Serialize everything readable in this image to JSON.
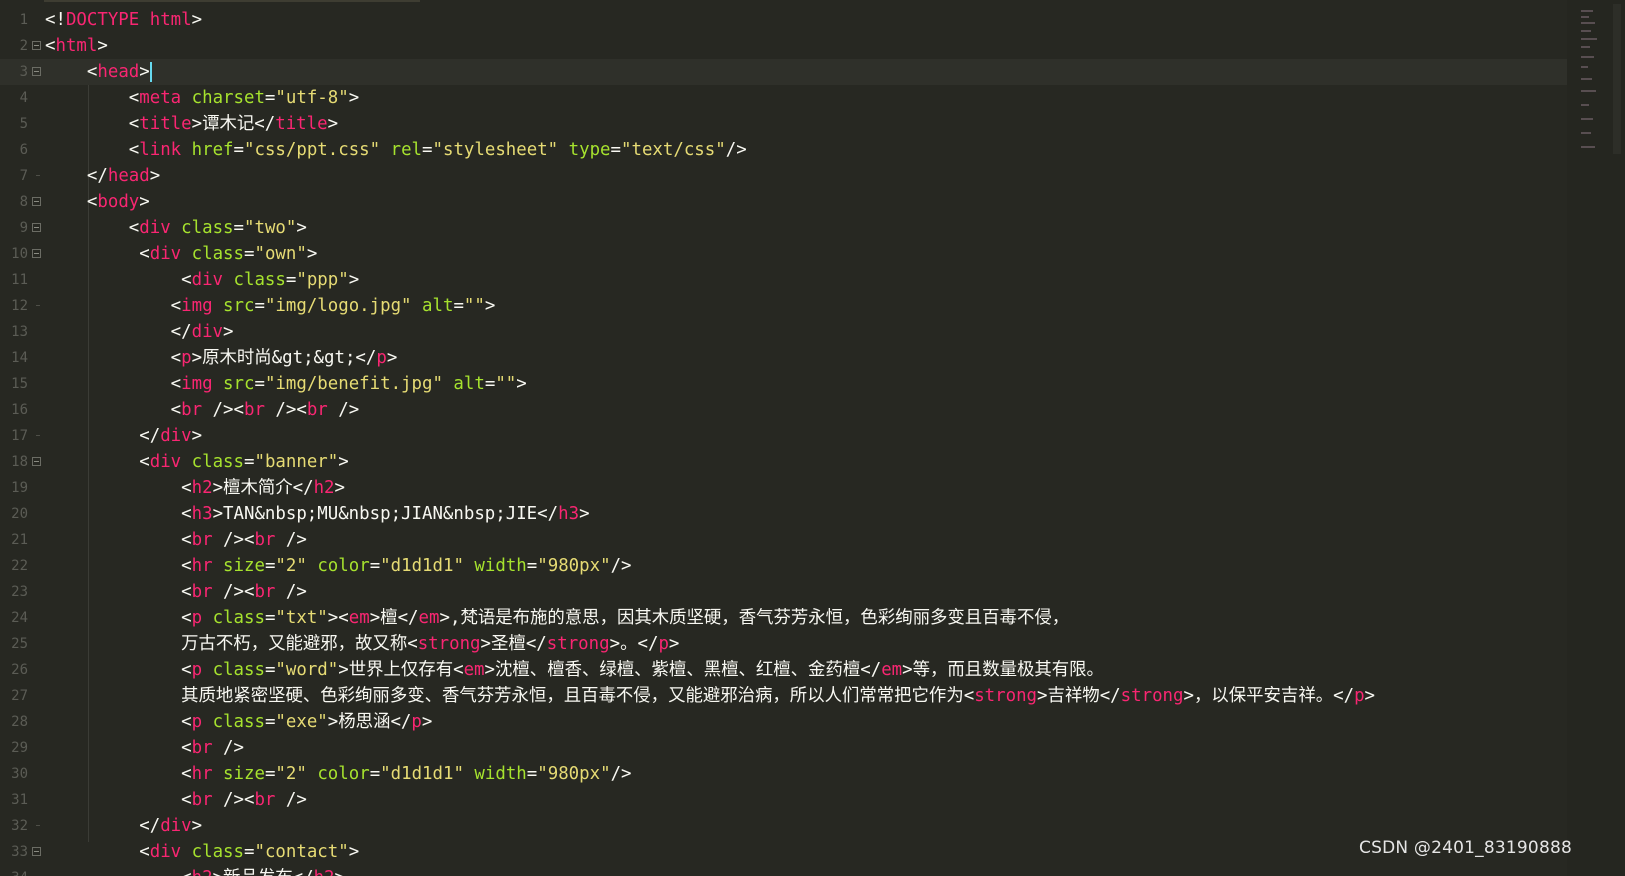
{
  "editor": {
    "theme_colors": {
      "background": "#272822",
      "tag": "#f92672",
      "attribute": "#a6e22e",
      "string": "#e6db74",
      "text": "#f8f8f2",
      "line_number": "#5b5c55",
      "cursor": "#66d9ef"
    },
    "cursor_line": 3,
    "lines": [
      {
        "n": "1",
        "fold": "",
        "ind": 0,
        "toks": [
          [
            "p",
            "<!"
          ],
          [
            "g",
            "DOCTYPE"
          ],
          [
            "p",
            " "
          ],
          [
            "g",
            "html"
          ],
          [
            "p",
            ">"
          ]
        ]
      },
      {
        "n": "2",
        "fold": "open",
        "ind": 0,
        "toks": [
          [
            "p",
            "<"
          ],
          [
            "g",
            "html"
          ],
          [
            "p",
            ">"
          ]
        ]
      },
      {
        "n": "3",
        "fold": "open",
        "ind": 4,
        "cursor": true,
        "toks": [
          [
            "p",
            "<"
          ],
          [
            "g",
            "head"
          ],
          [
            "p",
            ">"
          ]
        ]
      },
      {
        "n": "4",
        "fold": "",
        "ind": 8,
        "toks": [
          [
            "p",
            "<"
          ],
          [
            "g",
            "meta"
          ],
          [
            "p",
            " "
          ],
          [
            "a",
            "charset"
          ],
          [
            "p",
            "="
          ],
          [
            "s",
            "\"utf-8\""
          ],
          [
            "p",
            ">"
          ]
        ]
      },
      {
        "n": "5",
        "fold": "",
        "ind": 8,
        "toks": [
          [
            "p",
            "<"
          ],
          [
            "g",
            "title"
          ],
          [
            "p",
            ">"
          ],
          [
            "t",
            "谭木记"
          ],
          [
            "p",
            "</"
          ],
          [
            "g",
            "title"
          ],
          [
            "p",
            ">"
          ]
        ]
      },
      {
        "n": "6",
        "fold": "",
        "ind": 8,
        "toks": [
          [
            "p",
            "<"
          ],
          [
            "g",
            "link"
          ],
          [
            "p",
            " "
          ],
          [
            "a",
            "href"
          ],
          [
            "p",
            "="
          ],
          [
            "s",
            "\"css/ppt.css\""
          ],
          [
            "p",
            " "
          ],
          [
            "a",
            "rel"
          ],
          [
            "p",
            "="
          ],
          [
            "s",
            "\"stylesheet\""
          ],
          [
            "p",
            " "
          ],
          [
            "a",
            "type"
          ],
          [
            "p",
            "="
          ],
          [
            "s",
            "\"text/css\""
          ],
          [
            "p",
            "/>"
          ]
        ]
      },
      {
        "n": "7",
        "fold": "end",
        "ind": 4,
        "toks": [
          [
            "p",
            "</"
          ],
          [
            "g",
            "head"
          ],
          [
            "p",
            ">"
          ]
        ]
      },
      {
        "n": "8",
        "fold": "open",
        "ind": 4,
        "toks": [
          [
            "p",
            "<"
          ],
          [
            "g",
            "body"
          ],
          [
            "p",
            ">"
          ]
        ]
      },
      {
        "n": "9",
        "fold": "open",
        "ind": 8,
        "toks": [
          [
            "p",
            "<"
          ],
          [
            "g",
            "div"
          ],
          [
            "p",
            " "
          ],
          [
            "a",
            "class"
          ],
          [
            "p",
            "="
          ],
          [
            "s",
            "\"two\""
          ],
          [
            "p",
            ">"
          ]
        ]
      },
      {
        "n": "10",
        "fold": "open",
        "ind": 9,
        "toks": [
          [
            "p",
            "<"
          ],
          [
            "g",
            "div"
          ],
          [
            "p",
            " "
          ],
          [
            "a",
            "class"
          ],
          [
            "p",
            "="
          ],
          [
            "s",
            "\"own\""
          ],
          [
            "p",
            ">"
          ]
        ]
      },
      {
        "n": "11",
        "fold": "",
        "ind": 13,
        "toks": [
          [
            "p",
            "<"
          ],
          [
            "g",
            "div"
          ],
          [
            "p",
            " "
          ],
          [
            "a",
            "class"
          ],
          [
            "p",
            "="
          ],
          [
            "s",
            "\"ppp\""
          ],
          [
            "p",
            ">"
          ]
        ]
      },
      {
        "n": "12",
        "fold": "end",
        "ind": 12,
        "toks": [
          [
            "p",
            "<"
          ],
          [
            "g",
            "img"
          ],
          [
            "p",
            " "
          ],
          [
            "a",
            "src"
          ],
          [
            "p",
            "="
          ],
          [
            "s",
            "\"img/logo.jpg\""
          ],
          [
            "p",
            " "
          ],
          [
            "a",
            "alt"
          ],
          [
            "p",
            "="
          ],
          [
            "s",
            "\"\""
          ],
          [
            "p",
            ">"
          ]
        ]
      },
      {
        "n": "13",
        "fold": "",
        "ind": 12,
        "toks": [
          [
            "p",
            "</"
          ],
          [
            "g",
            "div"
          ],
          [
            "p",
            ">"
          ]
        ]
      },
      {
        "n": "14",
        "fold": "",
        "ind": 12,
        "toks": [
          [
            "p",
            "<"
          ],
          [
            "g",
            "p"
          ],
          [
            "p",
            ">"
          ],
          [
            "t",
            "原木时尚&gt;&gt;"
          ],
          [
            "p",
            "</"
          ],
          [
            "g",
            "p"
          ],
          [
            "p",
            ">"
          ]
        ]
      },
      {
        "n": "15",
        "fold": "",
        "ind": 12,
        "toks": [
          [
            "p",
            "<"
          ],
          [
            "g",
            "img"
          ],
          [
            "p",
            " "
          ],
          [
            "a",
            "src"
          ],
          [
            "p",
            "="
          ],
          [
            "s",
            "\"img/benefit.jpg\""
          ],
          [
            "p",
            " "
          ],
          [
            "a",
            "alt"
          ],
          [
            "p",
            "="
          ],
          [
            "s",
            "\"\""
          ],
          [
            "p",
            ">"
          ]
        ]
      },
      {
        "n": "16",
        "fold": "",
        "ind": 12,
        "toks": [
          [
            "p",
            "<"
          ],
          [
            "g",
            "br"
          ],
          [
            "p",
            " /><"
          ],
          [
            "g",
            "br"
          ],
          [
            "p",
            " /><"
          ],
          [
            "g",
            "br"
          ],
          [
            "p",
            " />"
          ]
        ]
      },
      {
        "n": "17",
        "fold": "end",
        "ind": 9,
        "toks": [
          [
            "p",
            "</"
          ],
          [
            "g",
            "div"
          ],
          [
            "p",
            ">"
          ]
        ]
      },
      {
        "n": "18",
        "fold": "open",
        "ind": 9,
        "toks": [
          [
            "p",
            "<"
          ],
          [
            "g",
            "div"
          ],
          [
            "p",
            " "
          ],
          [
            "a",
            "class"
          ],
          [
            "p",
            "="
          ],
          [
            "s",
            "\"banner\""
          ],
          [
            "p",
            ">"
          ]
        ]
      },
      {
        "n": "19",
        "fold": "",
        "ind": 13,
        "toks": [
          [
            "p",
            "<"
          ],
          [
            "g",
            "h2"
          ],
          [
            "p",
            ">"
          ],
          [
            "t",
            "檀木简介"
          ],
          [
            "p",
            "</"
          ],
          [
            "g",
            "h2"
          ],
          [
            "p",
            ">"
          ]
        ]
      },
      {
        "n": "20",
        "fold": "",
        "ind": 13,
        "toks": [
          [
            "p",
            "<"
          ],
          [
            "g",
            "h3"
          ],
          [
            "p",
            ">"
          ],
          [
            "t",
            "TAN&nbsp;MU&nbsp;JIAN&nbsp;JIE"
          ],
          [
            "p",
            "</"
          ],
          [
            "g",
            "h3"
          ],
          [
            "p",
            ">"
          ]
        ]
      },
      {
        "n": "21",
        "fold": "",
        "ind": 13,
        "toks": [
          [
            "p",
            "<"
          ],
          [
            "g",
            "br"
          ],
          [
            "p",
            " /><"
          ],
          [
            "g",
            "br"
          ],
          [
            "p",
            " />"
          ]
        ]
      },
      {
        "n": "22",
        "fold": "",
        "ind": 13,
        "toks": [
          [
            "p",
            "<"
          ],
          [
            "g",
            "hr"
          ],
          [
            "p",
            " "
          ],
          [
            "a",
            "size"
          ],
          [
            "p",
            "="
          ],
          [
            "s",
            "\"2\""
          ],
          [
            "p",
            " "
          ],
          [
            "a",
            "color"
          ],
          [
            "p",
            "="
          ],
          [
            "s",
            "\"d1d1d1\""
          ],
          [
            "p",
            " "
          ],
          [
            "a",
            "width"
          ],
          [
            "p",
            "="
          ],
          [
            "s",
            "\"980px\""
          ],
          [
            "p",
            "/>"
          ]
        ]
      },
      {
        "n": "23",
        "fold": "",
        "ind": 13,
        "toks": [
          [
            "p",
            "<"
          ],
          [
            "g",
            "br"
          ],
          [
            "p",
            " /><"
          ],
          [
            "g",
            "br"
          ],
          [
            "p",
            " />"
          ]
        ]
      },
      {
        "n": "24",
        "fold": "",
        "ind": 13,
        "toks": [
          [
            "p",
            "<"
          ],
          [
            "g",
            "p"
          ],
          [
            "p",
            " "
          ],
          [
            "a",
            "class"
          ],
          [
            "p",
            "="
          ],
          [
            "s",
            "\"txt\""
          ],
          [
            "p",
            "><"
          ],
          [
            "g",
            "em"
          ],
          [
            "p",
            ">"
          ],
          [
            "t",
            "檀"
          ],
          [
            "p",
            "</"
          ],
          [
            "g",
            "em"
          ],
          [
            "p",
            ">"
          ],
          [
            "t",
            ",梵语是布施的意思，因其木质坚硬，香气芬芳永恒，色彩绚丽多变且百毒不侵，"
          ]
        ]
      },
      {
        "n": "25",
        "fold": "",
        "ind": 13,
        "toks": [
          [
            "t",
            "万古不朽，又能避邪，故又称"
          ],
          [
            "p",
            "<"
          ],
          [
            "g",
            "strong"
          ],
          [
            "p",
            ">"
          ],
          [
            "t",
            "圣檀"
          ],
          [
            "p",
            "</"
          ],
          [
            "g",
            "strong"
          ],
          [
            "p",
            ">"
          ],
          [
            "t",
            "。"
          ],
          [
            "p",
            "</"
          ],
          [
            "g",
            "p"
          ],
          [
            "p",
            ">"
          ]
        ]
      },
      {
        "n": "26",
        "fold": "",
        "ind": 13,
        "toks": [
          [
            "p",
            "<"
          ],
          [
            "g",
            "p"
          ],
          [
            "p",
            " "
          ],
          [
            "a",
            "class"
          ],
          [
            "p",
            "="
          ],
          [
            "s",
            "\"word\""
          ],
          [
            "p",
            ">"
          ],
          [
            "t",
            "世界上仅存有"
          ],
          [
            "p",
            "<"
          ],
          [
            "g",
            "em"
          ],
          [
            "p",
            ">"
          ],
          [
            "t",
            "沈檀、檀香、绿檀、紫檀、黑檀、红檀、金药檀"
          ],
          [
            "p",
            "</"
          ],
          [
            "g",
            "em"
          ],
          [
            "p",
            ">"
          ],
          [
            "t",
            "等，而且数量极其有限。"
          ]
        ]
      },
      {
        "n": "27",
        "fold": "",
        "ind": 13,
        "toks": [
          [
            "t",
            "其质地紧密坚硬、色彩绚丽多变、香气芬芳永恒，且百毒不侵，又能避邪治病，所以人们常常把它作为"
          ],
          [
            "p",
            "<"
          ],
          [
            "g",
            "strong"
          ],
          [
            "p",
            ">"
          ],
          [
            "t",
            "吉祥物"
          ],
          [
            "p",
            "</"
          ],
          [
            "g",
            "strong"
          ],
          [
            "p",
            ">"
          ],
          [
            "t",
            "，以保平安吉祥。"
          ],
          [
            "p",
            "</"
          ],
          [
            "g",
            "p"
          ],
          [
            "p",
            ">"
          ]
        ]
      },
      {
        "n": "28",
        "fold": "",
        "ind": 13,
        "toks": [
          [
            "p",
            "<"
          ],
          [
            "g",
            "p"
          ],
          [
            "p",
            " "
          ],
          [
            "a",
            "class"
          ],
          [
            "p",
            "="
          ],
          [
            "s",
            "\"exe\""
          ],
          [
            "p",
            ">"
          ],
          [
            "t",
            "杨思涵"
          ],
          [
            "p",
            "</"
          ],
          [
            "g",
            "p"
          ],
          [
            "p",
            ">"
          ]
        ]
      },
      {
        "n": "29",
        "fold": "",
        "ind": 13,
        "toks": [
          [
            "p",
            "<"
          ],
          [
            "g",
            "br"
          ],
          [
            "p",
            " />"
          ]
        ]
      },
      {
        "n": "30",
        "fold": "",
        "ind": 13,
        "toks": [
          [
            "p",
            "<"
          ],
          [
            "g",
            "hr"
          ],
          [
            "p",
            " "
          ],
          [
            "a",
            "size"
          ],
          [
            "p",
            "="
          ],
          [
            "s",
            "\"2\""
          ],
          [
            "p",
            " "
          ],
          [
            "a",
            "color"
          ],
          [
            "p",
            "="
          ],
          [
            "s",
            "\"d1d1d1\""
          ],
          [
            "p",
            " "
          ],
          [
            "a",
            "width"
          ],
          [
            "p",
            "="
          ],
          [
            "s",
            "\"980px\""
          ],
          [
            "p",
            "/>"
          ]
        ]
      },
      {
        "n": "31",
        "fold": "",
        "ind": 13,
        "toks": [
          [
            "p",
            "<"
          ],
          [
            "g",
            "br"
          ],
          [
            "p",
            " /><"
          ],
          [
            "g",
            "br"
          ],
          [
            "p",
            " />"
          ]
        ]
      },
      {
        "n": "32",
        "fold": "end",
        "ind": 9,
        "toks": [
          [
            "p",
            "</"
          ],
          [
            "g",
            "div"
          ],
          [
            "p",
            ">"
          ]
        ]
      },
      {
        "n": "33",
        "fold": "open",
        "ind": 9,
        "toks": [
          [
            "p",
            "<"
          ],
          [
            "g",
            "div"
          ],
          [
            "p",
            " "
          ],
          [
            "a",
            "class"
          ],
          [
            "p",
            "="
          ],
          [
            "s",
            "\"contact\""
          ],
          [
            "p",
            ">"
          ]
        ]
      },
      {
        "n": "34",
        "fold": "",
        "ind": 13,
        "toks": [
          [
            "p",
            "<"
          ],
          [
            "g",
            "h2"
          ],
          [
            "p",
            ">"
          ],
          [
            "t",
            "新品发布"
          ],
          [
            "p",
            "</"
          ],
          [
            "g",
            "h2"
          ],
          [
            "p",
            ">"
          ]
        ]
      }
    ]
  },
  "watermark": {
    "text": "CSDN @2401_83190888"
  }
}
